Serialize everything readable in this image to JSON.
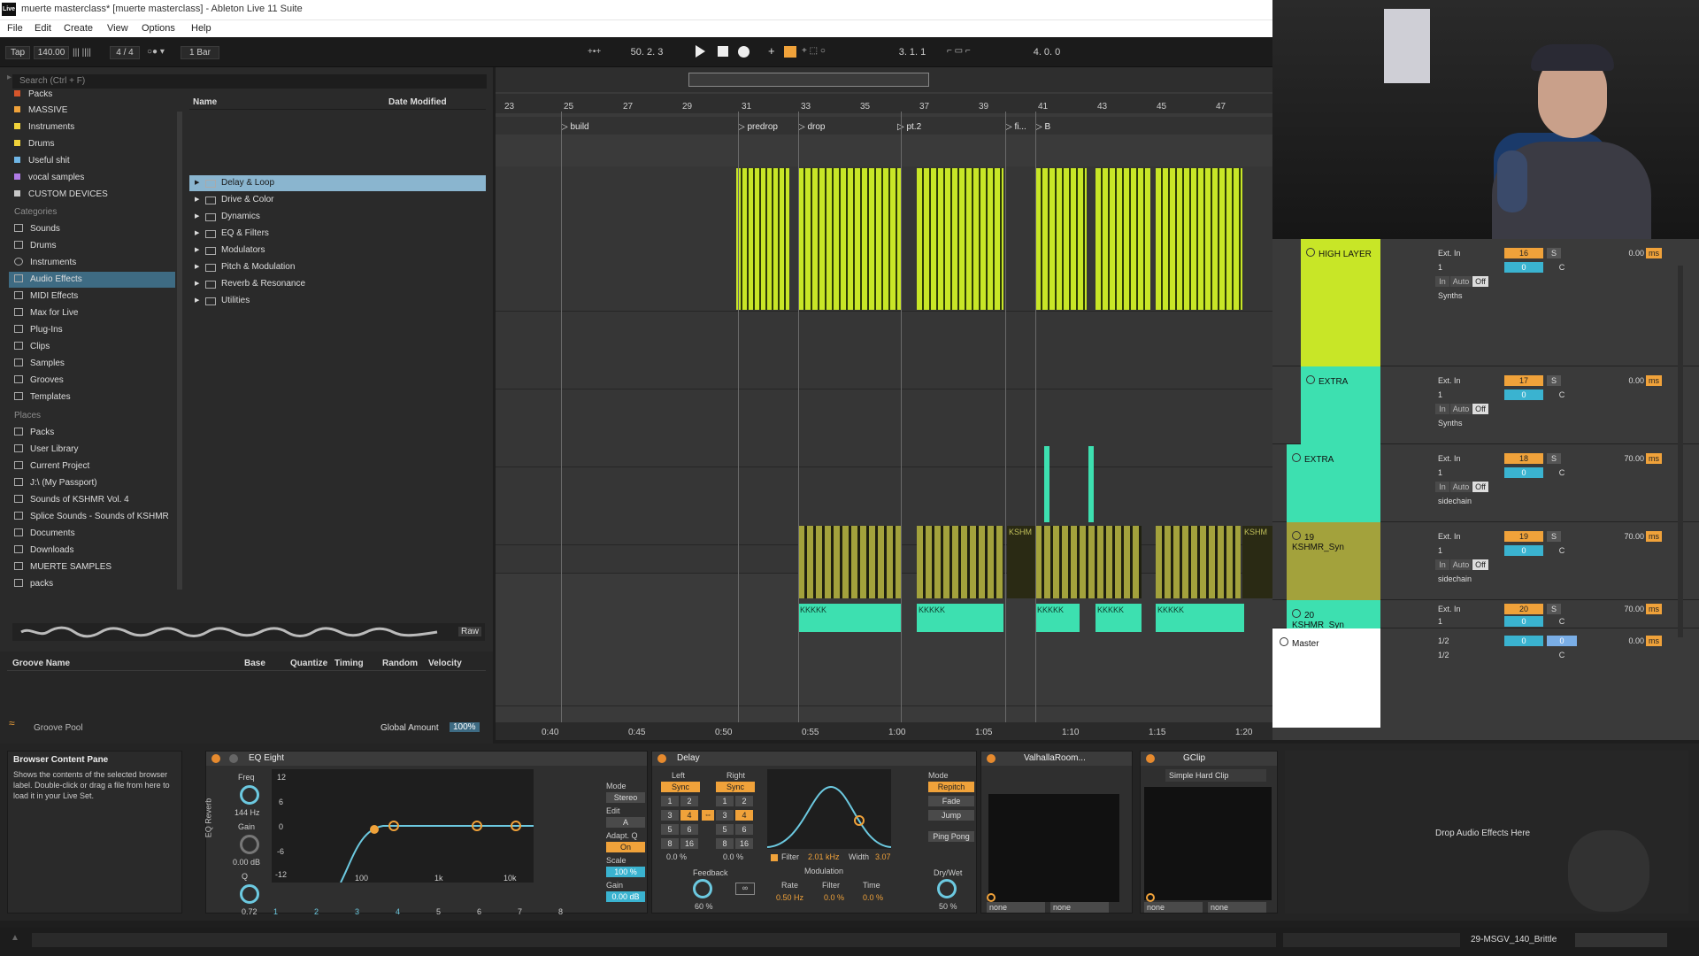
{
  "window": {
    "title": "muerte masterclass* [muerte masterclass] - Ableton Live 11 Suite",
    "logo": "Live"
  },
  "menu": [
    "File",
    "Edit",
    "Create",
    "View",
    "Options",
    "Help"
  ],
  "transport": {
    "tap": "Tap",
    "tempo": "140.00",
    "signature": "4 / 4",
    "quantize": "1 Bar",
    "position": "50.  2.  3",
    "loop_start": "3.  1.  1",
    "loop_length": "4.  0.  0"
  },
  "browser": {
    "search_placeholder": "Search (Ctrl + F)",
    "collections": [
      {
        "label": "Packs",
        "color": "#d6562b"
      },
      {
        "label": "MASSIVE",
        "color": "#f0a23a"
      },
      {
        "label": "Instruments",
        "color": "#f0d23a"
      },
      {
        "label": "Drums",
        "color": "#f0d23a"
      },
      {
        "label": "Useful shit",
        "color": "#6fb6e6"
      },
      {
        "label": "vocal samples",
        "color": "#b07be6"
      },
      {
        "label": "CUSTOM DEVICES",
        "color": "#c7c7c7"
      }
    ],
    "categories_title": "Categories",
    "categories": [
      "Sounds",
      "Drums",
      "Instruments",
      "Audio Effects",
      "MIDI Effects",
      "Max for Live",
      "Plug-Ins",
      "Clips",
      "Samples",
      "Grooves",
      "Templates"
    ],
    "places_title": "Places",
    "places": [
      "Packs",
      "User Library",
      "Current Project",
      "J:\\ (My Passport)",
      "Sounds of KSHMR Vol. 4",
      "Splice Sounds - Sounds of KSHMR",
      "Documents",
      "Downloads",
      "MUERTE SAMPLES",
      "packs"
    ],
    "columns": {
      "name": "Name",
      "date": "Date Modified"
    },
    "items": [
      "Delay & Loop",
      "Drive & Color",
      "Dynamics",
      "EQ & Filters",
      "Modulators",
      "Pitch & Modulation",
      "Reverb & Resonance",
      "Utilities"
    ],
    "raw": "Raw"
  },
  "groove": {
    "headers": [
      "Groove Name",
      "Base",
      "Quantize",
      "Timing",
      "Random",
      "Velocity"
    ],
    "pool": "Groove Pool",
    "global_amount_label": "Global Amount",
    "global_amount": "100%"
  },
  "arrangement": {
    "bars": [
      "23",
      "25",
      "27",
      "29",
      "31",
      "33",
      "35",
      "37",
      "39",
      "41",
      "43",
      "45",
      "47"
    ],
    "locators": [
      "build",
      "predrop",
      "drop",
      "pt.2",
      "fi...",
      "B"
    ],
    "times": [
      "0:40",
      "0:45",
      "0:50",
      "0:55",
      "1:00",
      "1:05",
      "1:10",
      "1:15",
      "1:20"
    ],
    "clip_label_k": "KKKKK",
    "clip_label_kshmr": "KSHM"
  },
  "mixer": {
    "tracks": [
      {
        "name": "HIGH LAYER",
        "color": "#c8e627",
        "input": "Ext. In",
        "ch": "1",
        "num": "16",
        "vol": "0.00",
        "unit": "ms",
        "route": "Synths"
      },
      {
        "name": "EXTRA",
        "color": "#3de0b0",
        "input": "Ext. In",
        "ch": "1",
        "num": "17",
        "vol": "0.00",
        "unit": "ms",
        "route": "Synths"
      },
      {
        "name": "EXTRA",
        "color": "#3de0b0",
        "input": "Ext. In",
        "ch": "1",
        "num": "18",
        "vol": "70.00",
        "unit": "ms",
        "route": "sidechain"
      },
      {
        "name": "19 KSHMR_Syn",
        "color": "#a3a23c",
        "input": "Ext. In",
        "ch": "1",
        "num": "19",
        "vol": "70.00",
        "unit": "ms",
        "route": "sidechain"
      },
      {
        "name": "20 KSHMR_Syn",
        "color": "#3de0b0",
        "input": "Ext. In",
        "ch": "1",
        "num": "20",
        "vol": "70.00",
        "unit": "ms",
        "route": ""
      }
    ],
    "master": {
      "name": "Master",
      "a": "1/2",
      "b": "1/2",
      "vol": "0.00",
      "unit": "ms"
    },
    "labels": {
      "in": "In",
      "auto": "Auto",
      "off": "Off",
      "s": "S",
      "c": "C",
      "zero": "0"
    }
  },
  "devices": {
    "info_title": "Browser Content Pane",
    "info_text": "Shows the contents of the selected browser label. Double-click or drag a file from here to load it in your Live Set.",
    "rack_label": "EQ Reverb",
    "eq": {
      "title": "EQ Eight",
      "freq_label": "Freq",
      "freq": "144 Hz",
      "gain_label": "Gain",
      "gain": "0.00 dB",
      "q_label": "Q",
      "q": "0.72",
      "scale_db": [
        "12",
        "6",
        "0",
        "-6",
        "-12"
      ],
      "scale_hz": [
        "100",
        "1k",
        "10k"
      ],
      "bands": [
        "1",
        "2",
        "3",
        "4",
        "5",
        "6",
        "7",
        "8"
      ],
      "mode_label": "Mode",
      "mode": "Stereo",
      "edit_label": "Edit",
      "edit": "A",
      "adapt_label": "Adapt. Q",
      "adapt": "On",
      "scale_label": "Scale",
      "scale": "100 %",
      "gain2_label": "Gain",
      "gain2": "0.00 dB"
    },
    "delay": {
      "title": "Delay",
      "left": "Left",
      "right": "Right",
      "sync": "Sync",
      "steps": [
        "1",
        "2",
        "3",
        "4",
        "5",
        "6",
        "8",
        "16"
      ],
      "left_offset": "0.0 %",
      "right_offset": "0.0 %",
      "filter_label": "Filter",
      "filter": "2.01 kHz",
      "width_label": "Width",
      "width": "3.07",
      "feedback_label": "Feedback",
      "feedback": "60 %",
      "mod_label": "Modulation",
      "rate_label": "Rate",
      "rate": "0.50 Hz",
      "mfilter_label": "Filter",
      "mfilter": "0.0 %",
      "time_label": "Time",
      "time": "0.0 %",
      "mode_label": "Mode",
      "modes": [
        "Repitch",
        "Fade",
        "Jump"
      ],
      "pingpong": "Ping Pong",
      "drywet_label": "Dry/Wet",
      "drywet": "50 %"
    },
    "valhalla": {
      "title": "ValhallaRoom...",
      "none1": "none",
      "none2": "none"
    },
    "gclip": {
      "title": "GClip",
      "preset": "Simple Hard Clip",
      "none1": "none",
      "none2": "none"
    },
    "drop": "Drop Audio Effects Here"
  },
  "status": {
    "clip": "29-MSGV_140_Brittle"
  }
}
